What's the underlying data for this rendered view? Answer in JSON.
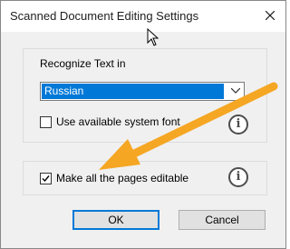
{
  "dialog": {
    "title": "Scanned Document Editing Settings",
    "close_icon": "close-icon"
  },
  "recognize": {
    "label": "Recognize Text in",
    "selected_language": "Russian"
  },
  "options": {
    "system_font_label": "Use available system font",
    "system_font_checked": false,
    "editable_label": "Make all the pages editable",
    "editable_checked": true
  },
  "buttons": {
    "ok_label": "OK",
    "cancel_label": "Cancel"
  },
  "colors": {
    "accent": "#0078d7",
    "arrow": "#f5a623"
  }
}
